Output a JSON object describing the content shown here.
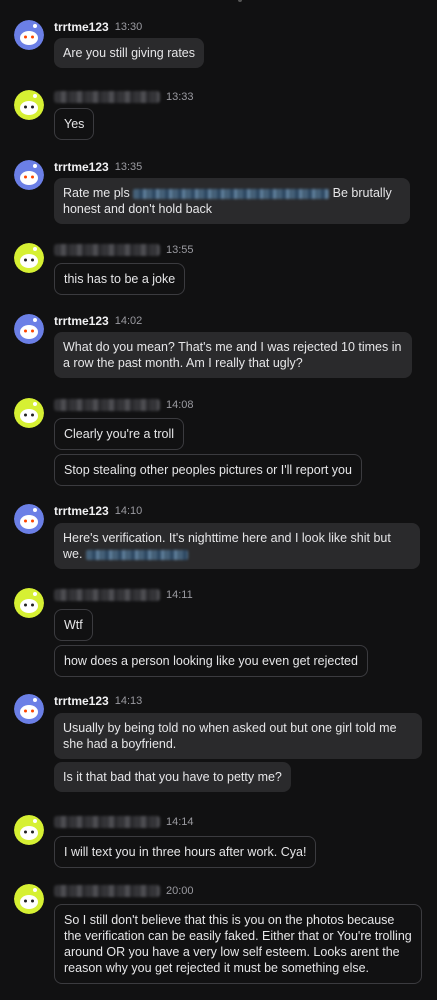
{
  "messages": [
    {
      "sender": "trrtme123",
      "time": "13:30",
      "avatar": "snoo-blue-avatar",
      "lines": [
        "Are you still giving rates"
      ]
    },
    {
      "sender": "",
      "time": "13:33",
      "avatar": "snoo-yellow-avatar",
      "lines": [
        "Yes"
      ]
    },
    {
      "sender": "trrtme123",
      "time": "13:35",
      "avatar": "snoo-blue-avatar",
      "lines": [
        "Rate me pls",
        "Be brutally honest and don't hold back"
      ]
    },
    {
      "sender": "",
      "time": "13:55",
      "avatar": "snoo-yellow-avatar",
      "lines": [
        "this has to be a joke"
      ]
    },
    {
      "sender": "trrtme123",
      "time": "14:02",
      "avatar": "snoo-blue-avatar",
      "lines": [
        "What do you mean? That's me and I was rejected 10 times in a row the past month. Am I really that ugly?"
      ]
    },
    {
      "sender": "",
      "time": "14:08",
      "avatar": "snoo-yellow-avatar",
      "lines": [
        "Clearly you're a troll",
        "Stop stealing other peoples pictures or I'll report you"
      ]
    },
    {
      "sender": "trrtme123",
      "time": "14:10",
      "avatar": "snoo-blue-avatar",
      "lines": [
        "Here's verification. It's nighttime here and I look like shit but we."
      ]
    },
    {
      "sender": "",
      "time": "14:11",
      "avatar": "snoo-yellow-avatar",
      "lines": [
        "Wtf",
        "how does a person looking like you even get rejected"
      ]
    },
    {
      "sender": "trrtme123",
      "time": "14:13",
      "avatar": "snoo-blue-avatar",
      "lines": [
        "Usually by being told no when asked out but one girl told me she had a boyfriend.",
        "Is it that bad that you have to petty me?"
      ]
    },
    {
      "sender": "",
      "time": "14:14",
      "avatar": "snoo-yellow-avatar",
      "lines": [
        "I will text you in three hours after work. Cya!"
      ]
    },
    {
      "sender": "",
      "time": "20:00",
      "avatar": "snoo-yellow-avatar",
      "lines": [
        "So I still don't believe that this is you on the photos because the verification can be easily faked. Either that or You're trolling around OR you have a very low self esteem. Looks arent the reason why you get rejected it must be something else."
      ]
    }
  ],
  "colors": {
    "background": "#111112",
    "bubble": "#2a2a2c",
    "avatar_blue": "#6b7fe6",
    "avatar_yellow": "#d6f033"
  }
}
